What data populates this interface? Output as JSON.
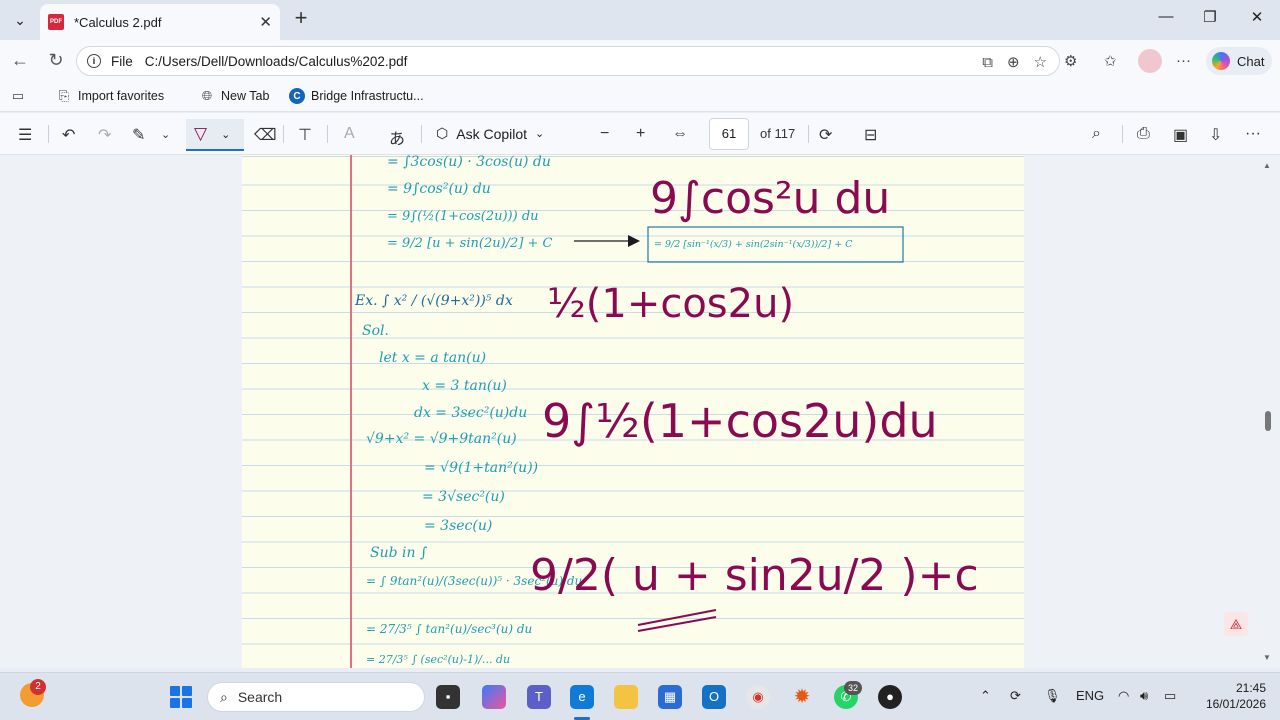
{
  "browser": {
    "tab_title": "*Calculus 2.pdf",
    "address_label": "File",
    "address_url": "C:/Users/Dell/Downloads/Calculus%202.pdf",
    "chat_label": "Chat"
  },
  "favorites": [
    {
      "label": "Import favorites",
      "icon": "import-icon"
    },
    {
      "label": "New Tab",
      "icon": "globe-icon"
    },
    {
      "label": "Bridge Infrastructu...",
      "icon": "bridge-site-icon"
    }
  ],
  "pdf_toolbar": {
    "ask_copilot": "Ask Copilot",
    "page_number": "61",
    "page_total": "of 117"
  },
  "notes": {
    "lines": [
      "= ∫3cos(u) · 3cos(u) du",
      "= 9∫cos²(u) du",
      "= 9∫(½(1+cos(2u))) du",
      "= 9/2 [u + sin(2u)/2] + C",
      "= 9/2 [sin⁻¹(x/3) + sin(2sin⁻¹(x/3))/2] + C",
      "Ex. ∫ x² / (√(9+x²))⁵ dx",
      "Sol.",
      "let x = a tan(u)",
      "x = 3 tan(u)",
      "dx = 3sec²(u)du",
      "√9+x² = √9+9tan²(u)",
      "= √9(1+tan²(u))",
      "= 3√sec²(u)",
      "= 3sec(u)",
      "Sub in ∫",
      "= ∫ 9tan²(u)/(3sec(u))⁵ · 3sec²(u) du",
      "= 27/3⁵ ∫ tan²(u)/sec³(u) du",
      "= 27/3⁵ ∫ (sec²(u)-1)/... du"
    ],
    "ink": [
      "9∫cos²u du",
      "½(1+cos2u)",
      "9∫½(1+cos2u)du",
      "9/2( u + sin2u/2 )+c"
    ]
  },
  "taskbar": {
    "search_label": "Search",
    "weather_badge": "2",
    "teams_badge": "32",
    "lang": "ENG",
    "time": "21:45",
    "date": "16/01/2026"
  },
  "colors": {
    "ink": "#8a0a52",
    "notes": "#1f9db3",
    "margin_line": "#e07082",
    "accent": "#1a6fd1"
  }
}
